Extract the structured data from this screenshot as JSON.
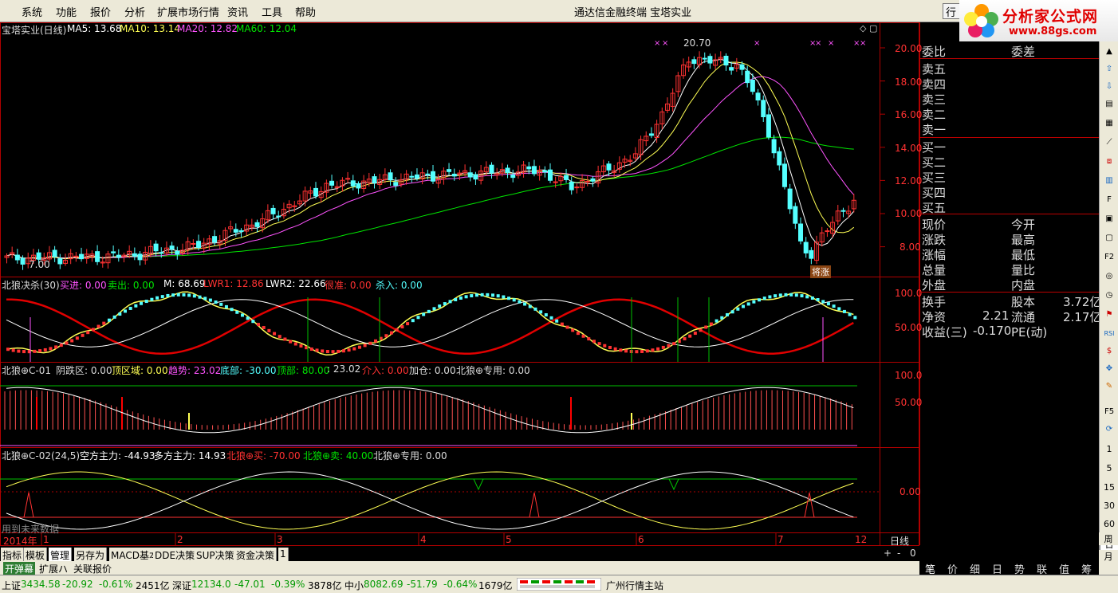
{
  "menu": {
    "items": [
      "系统",
      "功能",
      "报价",
      "分析",
      "扩展市场行情",
      "资讯",
      "工具",
      "帮助"
    ],
    "center_title": "通达信金融终端   宝塔实业",
    "quote_btn": "行"
  },
  "logo": {
    "title": "分析家公式网",
    "url": "www.88gs.com"
  },
  "ma_legend": {
    "name": "宝塔实业(日线)",
    "ma5": "MA5: 13.68",
    "ma10": "MA10: 13.14",
    "ma20": "MA20: 12.82",
    "ma60": "MA60: 12.04"
  },
  "price_axis": [
    "20.00",
    "18.00",
    "16.00",
    "14.00",
    "12.00",
    "10.00",
    "8.00"
  ],
  "price_annot": {
    "high": "20.70",
    "low": "7.00",
    "tag": "将涨"
  },
  "ind1": {
    "title": "北狼决杀(30)",
    "buy": "买进: 0.00",
    "sell": "卖出: 0.00",
    "m": "M: 68.69",
    "lwr1": "LWR1: 12.86",
    "lwr2": "LWR2: 22.66",
    "hen": "很准: 0.00",
    "kill": "杀入: 0.00",
    "axis": [
      "100.0",
      "50.00"
    ]
  },
  "ind2": {
    "title": "北狼⊕C-01",
    "yin": "阴跌区: 0.00",
    "top": "顶区域: 0.00",
    "trend": "趋势: 23.02",
    "bottom": "底部: -30.00",
    "toppart": "顶部: 80.00",
    "val": ": 23.02",
    "jieru": "介入: 0.00",
    "jiacang": "加仓: 0.00",
    "special": "北狼⊕专用: 0.00",
    "axis": [
      "100.0",
      "50.00"
    ]
  },
  "ind3": {
    "title": "北狼⊕C-02(24,5)",
    "kong": "空方主力: -44.93",
    "duo": "多方主力: 14.93",
    "buy": "北狼⊕买: -70.00",
    "sell": "北狼⊕卖: 40.00",
    "special": "北狼⊕专用: 0.00",
    "axis": [
      "0.00"
    ],
    "future": "用到未来数据"
  },
  "time_axis": {
    "year": "2014年",
    "labels": [
      "1",
      "2",
      "3",
      "4",
      "5",
      "6",
      "7",
      "12"
    ],
    "period": "日线"
  },
  "orderbook": {
    "wb": "委比",
    "wc": "委差",
    "sells": [
      "卖五",
      "卖四",
      "卖三",
      "卖二",
      "卖一"
    ],
    "buys": [
      "买一",
      "买二",
      "买三",
      "买四",
      "买五"
    ],
    "left": [
      "现价",
      "涨跌",
      "涨幅",
      "总量",
      "外盘"
    ],
    "right": [
      "今开",
      "最高",
      "最低",
      "量比",
      "内盘"
    ],
    "hs": "换手",
    "gb": "股本",
    "gb_val": "3.72亿",
    "jz": "净资",
    "jz_val": "2.21",
    "lt": "流通",
    "lt_val": "2.17亿",
    "sy": "收益(三)",
    "sy_val": "-0.170",
    "pe": "PE(动)"
  },
  "tabs": [
    "指标",
    "模板",
    "管理",
    "另存为",
    "MACD基本",
    "DDE决策",
    "SUP决策",
    "资金决策",
    "1"
  ],
  "tabs2": [
    "开弹幕",
    "扩展ハ",
    "关联报价"
  ],
  "zoom": [
    "+",
    "-",
    "0"
  ],
  "bottom_tabs": [
    "笔",
    "价",
    "细",
    "日",
    "势",
    "联",
    "值",
    "筹"
  ],
  "sidebar_nums": [
    "1",
    "5",
    "15",
    "30",
    "60"
  ],
  "sidebar_tail": [
    "日",
    "周",
    "月"
  ],
  "status": {
    "sh_label": "上证",
    "sh": "3434.58",
    "sh_chg": "-20.92",
    "sh_pct": "-0.61%",
    "sh_amt": "2451亿",
    "sz_label": "深证",
    "sz": "12134.0",
    "sz_chg": "-47.01",
    "sz_pct": "-0.39%",
    "sz_amt": "3878亿",
    "zx_label": "中小",
    "zx": "8082.69",
    "zx_chg": "-51.79",
    "zx_pct": "-0.64%",
    "zx_amt": "1679亿",
    "site": "广州行情主站"
  },
  "colors": {
    "up": "#ff3232",
    "down": "#54ffff",
    "ma5": "#ffffff",
    "ma10": "#ffff54",
    "ma20": "#ff54ff",
    "ma60": "#00e600",
    "frame": "#b00000"
  }
}
